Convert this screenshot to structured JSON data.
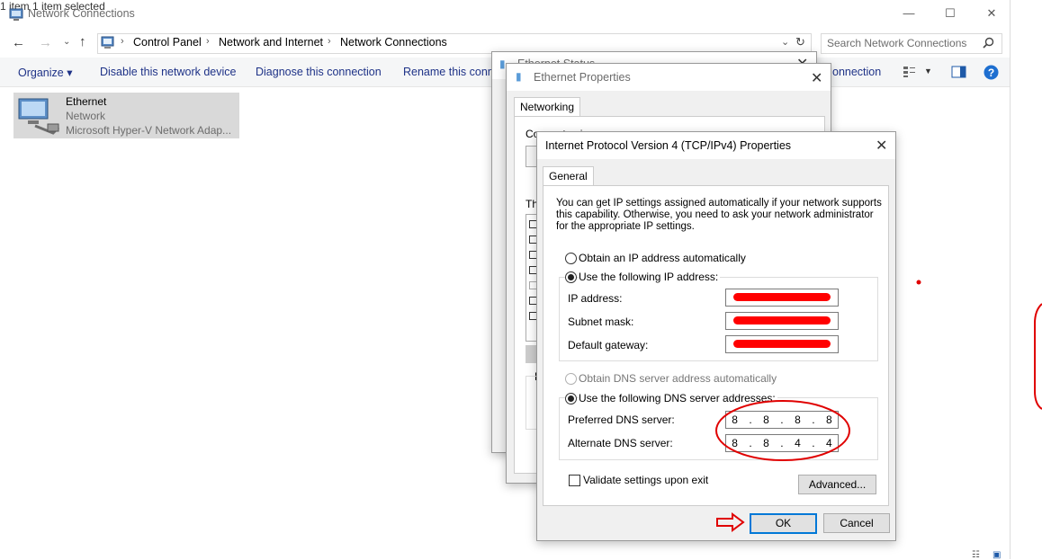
{
  "explorer": {
    "title": "Network Connections",
    "window_buttons": {
      "minimize": "—",
      "maximize": "☐",
      "close": "✕"
    },
    "breadcrumbs": [
      "Control Panel",
      "Network and Internet",
      "Network Connections"
    ],
    "search_placeholder": "Search Network Connections",
    "commands": [
      "Organize ▾",
      "Disable this network device",
      "Diagnose this connection",
      "Rename this conne",
      "onnection"
    ],
    "item": {
      "name": "Ethernet",
      "type": "Network",
      "adapter": "Microsoft Hyper-V Network Adap..."
    },
    "status": {
      "count": "1 item",
      "selected": "1 item selected"
    }
  },
  "ethernet_status": {
    "title": "Ethernet Status"
  },
  "ethernet_props": {
    "title": "Ethernet Properties",
    "tab": "Networking",
    "connect_using": "Connect using:",
    "this_connection": "Th",
    "desc_prefix": "D"
  },
  "ipv4": {
    "title": "Internet Protocol Version 4 (TCP/IPv4) Properties",
    "tab": "General",
    "intro": "You can get IP settings assigned automatically if your network supports this capability. Otherwise, you need to ask your network administrator for the appropriate IP settings.",
    "intro_lines": [
      "You can get IP settings assigned automatically if your network supports",
      "this capability. Otherwise, you need to ask your network administrator",
      "for the appropriate IP settings."
    ],
    "obtain_ip_auto": "Obtain an IP address automatically",
    "use_following_ip": "Use the following IP address:",
    "ip_label": "IP address:",
    "subnet_label": "Subnet mask:",
    "gateway_label": "Default gateway:",
    "obtain_dns_auto": "Obtain DNS server address automatically",
    "use_following_dns": "Use the following DNS server addresses:",
    "preferred_dns_label": "Preferred DNS server:",
    "alternate_dns_label": "Alternate DNS server:",
    "preferred_dns": [
      "8",
      "8",
      "8",
      "8"
    ],
    "alternate_dns": [
      "8",
      "8",
      "4",
      "4"
    ],
    "validate_label": "Validate settings upon exit",
    "advanced_label": "Advanced...",
    "ok_label": "OK",
    "cancel_label": "Cancel"
  },
  "colors": {
    "accent": "#0078d7",
    "annotation": "#e00000",
    "link": "#1e3287"
  }
}
